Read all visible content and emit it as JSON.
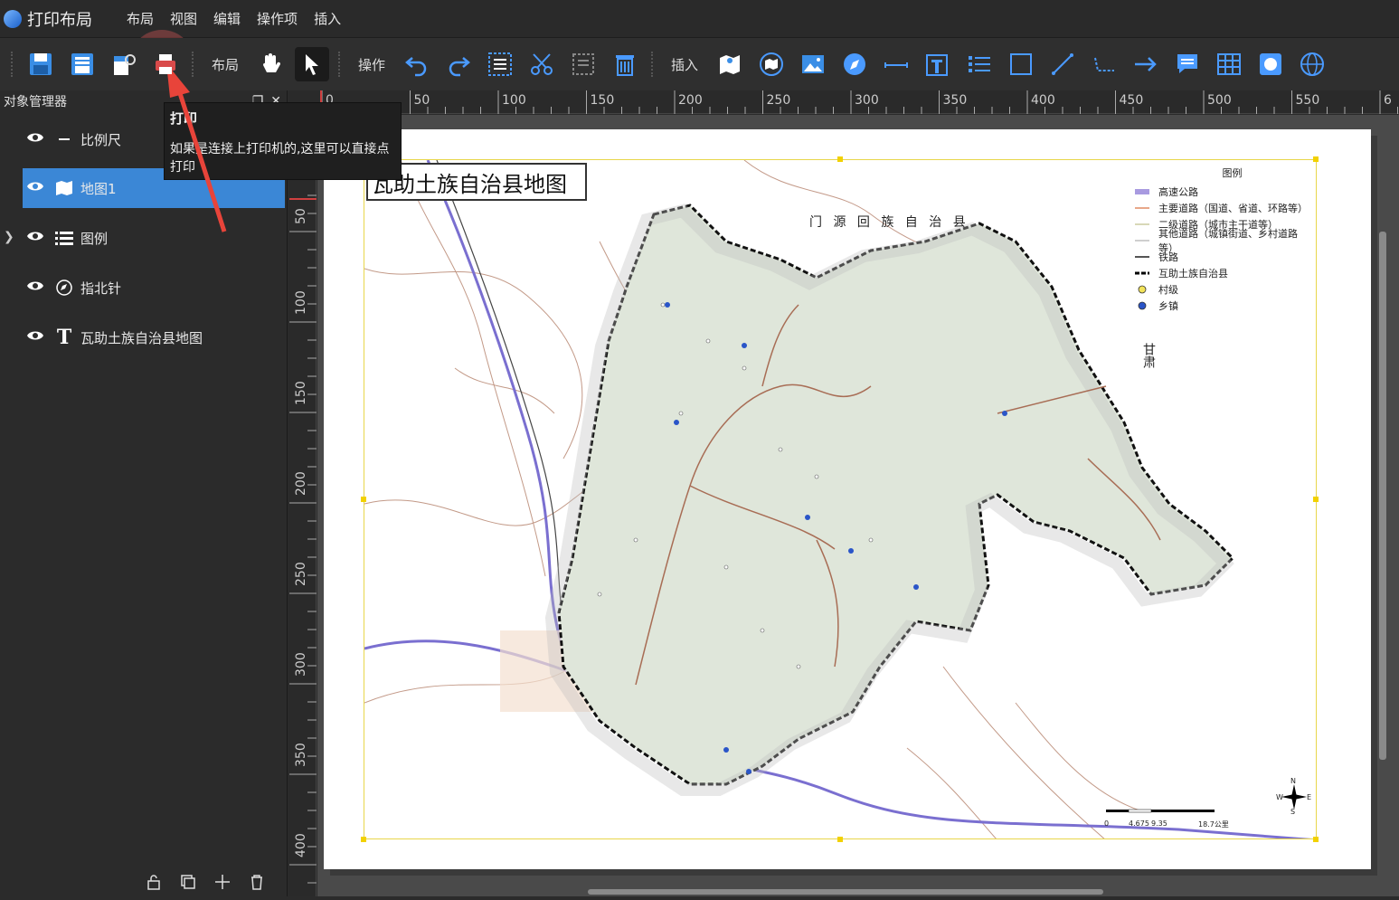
{
  "app": {
    "title": "打印布局"
  },
  "menu": {
    "items": [
      "布局",
      "视图",
      "编辑",
      "操作项",
      "插入"
    ]
  },
  "toolbar": {
    "layout_label": "布局",
    "operate_label": "操作",
    "insert_label": "插入"
  },
  "panel": {
    "title": "对象管理器"
  },
  "layers": [
    {
      "label": "比例尺"
    },
    {
      "label": "地图1"
    },
    {
      "label": "图例"
    },
    {
      "label": "指北针"
    },
    {
      "label": "瓦助土族自治县地图"
    }
  ],
  "tooltip": {
    "title": "打印",
    "body": "如果是连接上打印机的,这里可以直接点打印"
  },
  "ruler": {
    "top_ticks": [
      "0",
      "50",
      "100",
      "150",
      "200",
      "250",
      "300",
      "350",
      "400",
      "450",
      "500",
      "550",
      "6"
    ],
    "left_ticks": [
      "50",
      "100",
      "150",
      "200",
      "250",
      "300",
      "350",
      "400"
    ]
  },
  "map": {
    "title": "瓦助土族自治县地图",
    "label_north": "门 源 回 族 自 治 县",
    "label_east": "甘肃",
    "legend_title": "图例",
    "legend_items": [
      {
        "label": "高速公路",
        "color": "#a89ae0"
      },
      {
        "label": "主要道路（国道、省道、环路等）",
        "color": "#e8a88a"
      },
      {
        "label": "二级道路（城市主干道等）",
        "color": "#d8d8b8"
      },
      {
        "label": "其他道路（城镇街道、乡村道路等）",
        "color": "#cfcfcf"
      },
      {
        "label": "铁路",
        "color": "#555555"
      },
      {
        "label": "互助土族自治县",
        "color": "#000000"
      },
      {
        "label": "村级",
        "color": "#f2e35a"
      },
      {
        "label": "乡镇",
        "color": "#2a55c8"
      }
    ],
    "scale_labels": [
      "0",
      "4.675",
      "9.35",
      "18.7公里"
    ],
    "compass": {
      "n": "N",
      "e": "E",
      "s": "S",
      "w": "W"
    },
    "county_fill": "#dfe6da"
  }
}
